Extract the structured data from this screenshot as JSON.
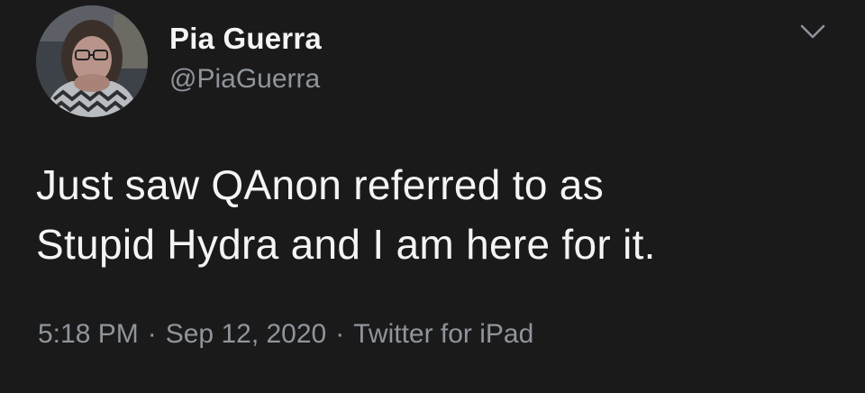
{
  "author": {
    "display_name": "Pia Guerra",
    "handle": "@PiaGuerra"
  },
  "tweet": {
    "text": "Just saw QAnon  referred to as\nStupid Hydra and I am here for it."
  },
  "meta": {
    "time": "5:18 PM",
    "separator": "·",
    "date": "Sep 12, 2020",
    "source": "Twitter for iPad"
  },
  "icons": {
    "menu": "chevron-down-icon"
  },
  "colors": {
    "background": "#1b1a1b",
    "primary_text": "#f4f4f4",
    "secondary_text": "#8f959b"
  }
}
